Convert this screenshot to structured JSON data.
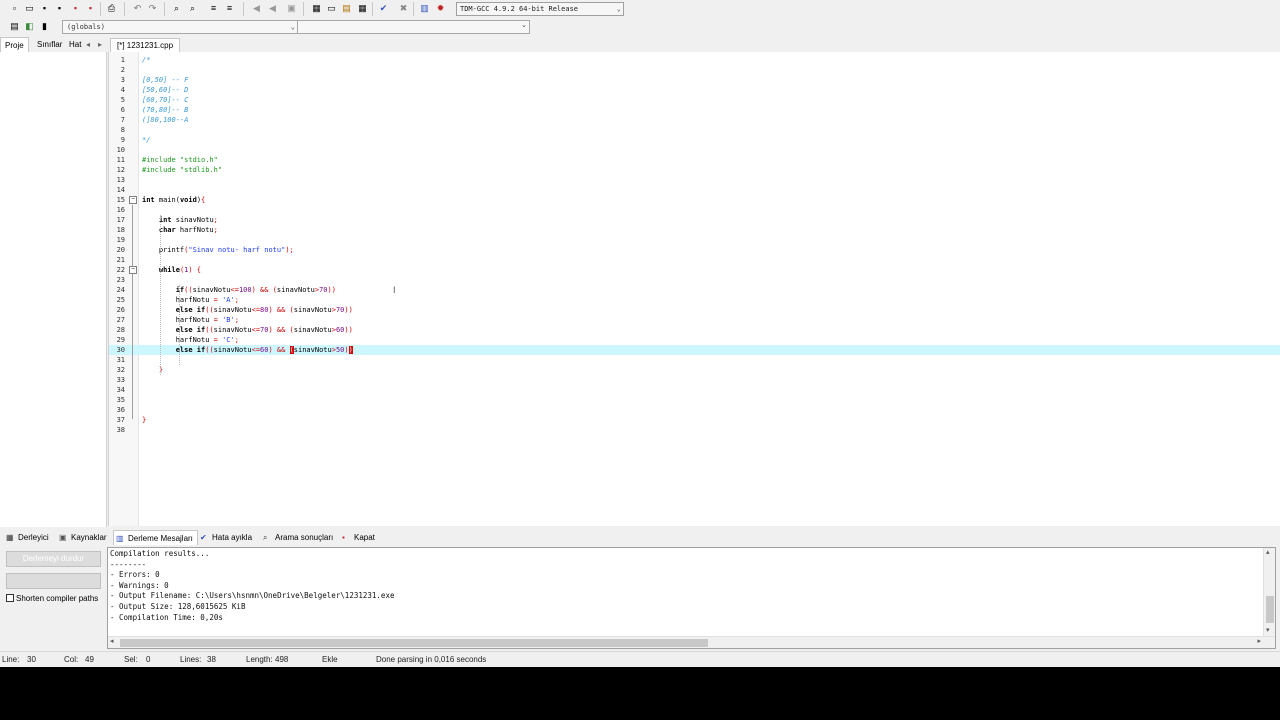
{
  "toolbar": {
    "icons": [
      "new-file-icon",
      "open-icon",
      "save-icon",
      "save-all-icon",
      "close-icon",
      "close-all-icon",
      "print-icon",
      "undo-icon",
      "redo-icon",
      "find-icon",
      "replace-icon",
      "indent-icon",
      "unindent-icon",
      "bookmark-prev-icon",
      "bookmark-next-icon",
      "toggle-bookmark-icon",
      "new-project-icon",
      "view-icon",
      "window-icon",
      "grid-icon",
      "check-icon",
      "cross-icon",
      "chart-icon",
      "debug-icon"
    ],
    "compiler": "TDM-GCC 4.9.2 64-bit Release"
  },
  "scope": {
    "value": "(globals)",
    "function_value": ""
  },
  "left_panel": {
    "tabs": [
      "Proje",
      "Sınıflar",
      "Hat"
    ]
  },
  "editor": {
    "tab_label": "[*] 1231231.cpp",
    "lines": [
      {
        "n": "1",
        "html": "<span class='c-comment'>/*</span>"
      },
      {
        "n": "2",
        "html": ""
      },
      {
        "n": "3",
        "html": "<span class='c-comment'>[0,50] -- F</span>"
      },
      {
        "n": "4",
        "html": "<span class='c-comment'>[50,60]-- D</span>"
      },
      {
        "n": "5",
        "html": "<span class='c-comment'>[60,70]-- C</span>"
      },
      {
        "n": "6",
        "html": "<span class='c-comment'>(70,80]-- B</span>"
      },
      {
        "n": "7",
        "html": "<span class='c-comment'>(]80,100--A</span>"
      },
      {
        "n": "8",
        "html": ""
      },
      {
        "n": "9",
        "html": "<span class='c-comment'>*/</span>"
      },
      {
        "n": "10",
        "html": ""
      },
      {
        "n": "11",
        "html": "<span class='c-pre'>#include \"stdio.h\"</span>"
      },
      {
        "n": "12",
        "html": "<span class='c-pre'>#include \"stdlib.h\"</span>"
      },
      {
        "n": "13",
        "html": ""
      },
      {
        "n": "14",
        "html": ""
      },
      {
        "n": "15",
        "html": "<span class='c-kw'>int</span> main(<span class='c-kw'>void</span>)<span class='c-sym'>{</span>"
      },
      {
        "n": "16",
        "html": ""
      },
      {
        "n": "17",
        "html": "    <span class='c-kw'>int</span> sinavNotu<span class='c-sym'>;</span>"
      },
      {
        "n": "18",
        "html": "    <span class='c-kw'>char</span> harfNotu<span class='c-sym'>;</span>"
      },
      {
        "n": "19",
        "html": ""
      },
      {
        "n": "20",
        "html": "    printf<span class='c-sym'>(</span><span class='c-str'>\"Sinav notu- harf notu\"</span><span class='c-sym'>);</span>"
      },
      {
        "n": "21",
        "html": ""
      },
      {
        "n": "22",
        "html": "    <span class='c-kw'>while</span><span class='c-sym'>(</span><span class='c-num'>1</span><span class='c-sym'>) {</span>"
      },
      {
        "n": "23",
        "html": ""
      },
      {
        "n": "24",
        "html": "        <span class='c-kw'>if</span><span class='c-sym'>((</span>sinavNotu<span class='c-sym'>&lt;=</span><span class='c-num'>100</span><span class='c-sym'>) &amp;&amp; (</span>sinavNotu<span class='c-sym'>&gt;</span><span class='c-num'>70</span><span class='c-sym'>))</span>"
      },
      {
        "n": "25",
        "html": "        harfNotu <span class='c-sym'>=</span> <span class='c-str'>'A'</span><span class='c-sym'>;</span>"
      },
      {
        "n": "26",
        "html": "        <span class='c-kw'>else if</span><span class='c-sym'>((</span>sinavNotu<span class='c-sym'>&lt;=</span><span class='c-num'>80</span><span class='c-sym'>) &amp;&amp; (</span>sinavNotu<span class='c-sym'>&gt;</span><span class='c-num'>70</span><span class='c-sym'>))</span>"
      },
      {
        "n": "27",
        "html": "        harfNotu <span class='c-sym'>=</span> <span class='c-str'>'B'</span><span class='c-sym'>;</span>"
      },
      {
        "n": "28",
        "html": "        <span class='c-kw'>else if</span><span class='c-sym'>((</span>sinavNotu<span class='c-sym'>&lt;=</span><span class='c-num'>70</span><span class='c-sym'>) &amp;&amp; (</span>sinavNotu<span class='c-sym'>&gt;</span><span class='c-num'>60</span><span class='c-sym'>))</span>"
      },
      {
        "n": "29",
        "html": "        harfNotu <span class='c-sym'>=</span> <span class='c-str'>'C'</span><span class='c-sym'>;</span>"
      },
      {
        "n": "30",
        "html": "        <span class='c-kw'>else if</span><span class='c-sym'>((</span>sinavNotu<span class='c-sym'>&lt;=</span><span class='c-num'>60</span><span class='c-sym'>) &amp;&amp; </span><span class='c-brace-hl'>(</span>sinavNotu<span class='c-sym'>&gt;</span><span class='c-num'>50</span><span class='c-sym'>)</span><span class='c-brace-hl'>)</span>"
      },
      {
        "n": "31",
        "html": ""
      },
      {
        "n": "32",
        "html": "    <span class='c-sym'>}</span>"
      },
      {
        "n": "33",
        "html": ""
      },
      {
        "n": "34",
        "html": ""
      },
      {
        "n": "35",
        "html": ""
      },
      {
        "n": "36",
        "html": ""
      },
      {
        "n": "37",
        "html": "<span class='c-sym'>}</span>"
      },
      {
        "n": "38",
        "html": ""
      }
    ]
  },
  "bottom_tabs": [
    {
      "label": "Derleyici",
      "icon": "grid-icon"
    },
    {
      "label": "Kaynaklar",
      "icon": "resources-icon"
    },
    {
      "label": "Derleme Mesajları",
      "icon": "chart-icon"
    },
    {
      "label": "Hata ayıkla",
      "icon": "check-icon"
    },
    {
      "label": "Arama sonuçları",
      "icon": "search-icon"
    },
    {
      "label": "Kapat",
      "icon": "close-icon"
    }
  ],
  "bottom_left": {
    "stop_button": "Derlemeyi durdur",
    "shorten_label": "Shorten compiler paths"
  },
  "output": {
    "lines": [
      "Compilation results...",
      "--------",
      "- Errors: 0",
      "- Warnings: 0",
      "- Output Filename: C:\\Users\\hsnmn\\OneDrive\\Belgeler\\1231231.exe",
      "- Output Size: 128,6015625 KiB",
      "- Compilation Time: 0,20s"
    ]
  },
  "status": {
    "line_label": "Line:",
    "line_value": "30",
    "col_label": "Col:",
    "col_value": "49",
    "sel_label": "Sel:",
    "sel_value": "0",
    "lines_label": "Lines:",
    "lines_value": "38",
    "length_label": "Length:",
    "length_value": "498",
    "mode": "Ekle",
    "message": "Done parsing in 0,016 seconds"
  }
}
